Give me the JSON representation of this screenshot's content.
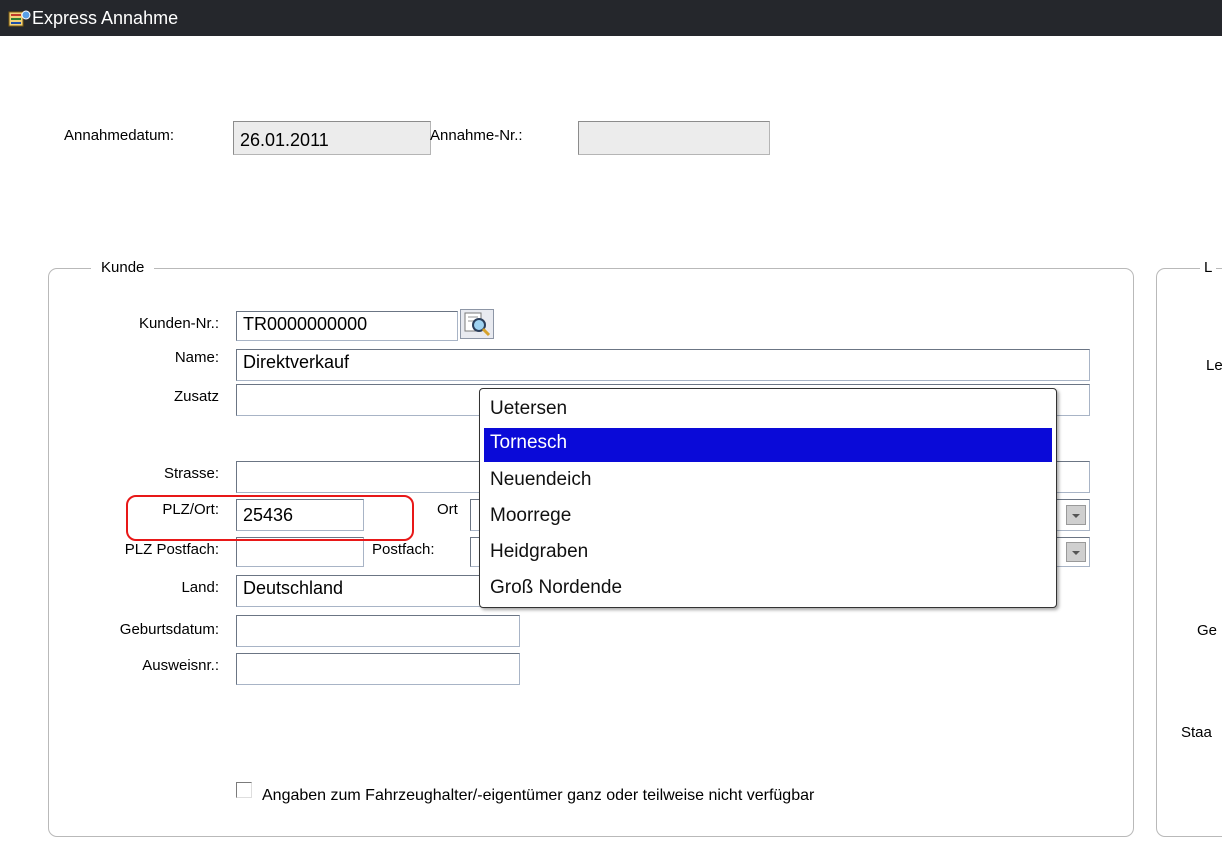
{
  "window": {
    "title": "Express Annahme",
    "icon": "app-form-icon"
  },
  "header": {
    "annahmedatum_label": "Annahmedatum:",
    "annahmedatum_value": "26.01.2011",
    "annahme_nr_label": "Annahme-Nr.:",
    "annahme_nr_value": ""
  },
  "kunde": {
    "legend": "Kunde",
    "kunden_nr_label": "Kunden-Nr.:",
    "kunden_nr_value": "TR0000000000",
    "lookup_icon": "search-lookup-icon",
    "name_label": "Name:",
    "name_value": "Direktverkauf",
    "zusatz_label": "Zusatz",
    "zusatz_value": "",
    "strasse_label": "Strasse:",
    "strasse_value": "",
    "plz_ort_label": "PLZ/Ort:",
    "plz_value": "25436",
    "ort_label": "Ort",
    "plz_postfach_label": "PLZ Postfach:",
    "plz_postfach_value": "",
    "postfach_label": "Postfach:",
    "land_label": "Land:",
    "land_value": "Deutschland",
    "geburtsdatum_label": "Geburtsdatum:",
    "geburtsdatum_value": "",
    "ausweisnr_label": "Ausweisnr.:",
    "ausweisnr_value": "",
    "checkbox_label": "Angaben zum Fahrzeughalter/-eigentümer ganz oder teilweise nicht verfügbar",
    "checkbox_checked": false
  },
  "ort_dropdown": {
    "options": [
      "Uetersen",
      "Tornesch",
      "Neuendeich",
      "Moorrege",
      "Heidgraben",
      "Groß Nordende"
    ],
    "selected_index": 1,
    "selected_color": "#0a0ad8"
  },
  "right_panel": {
    "legend_fragment": "L",
    "labels": [
      "Le",
      "Ge",
      "Staa"
    ]
  },
  "highlight_color": "#e81818"
}
